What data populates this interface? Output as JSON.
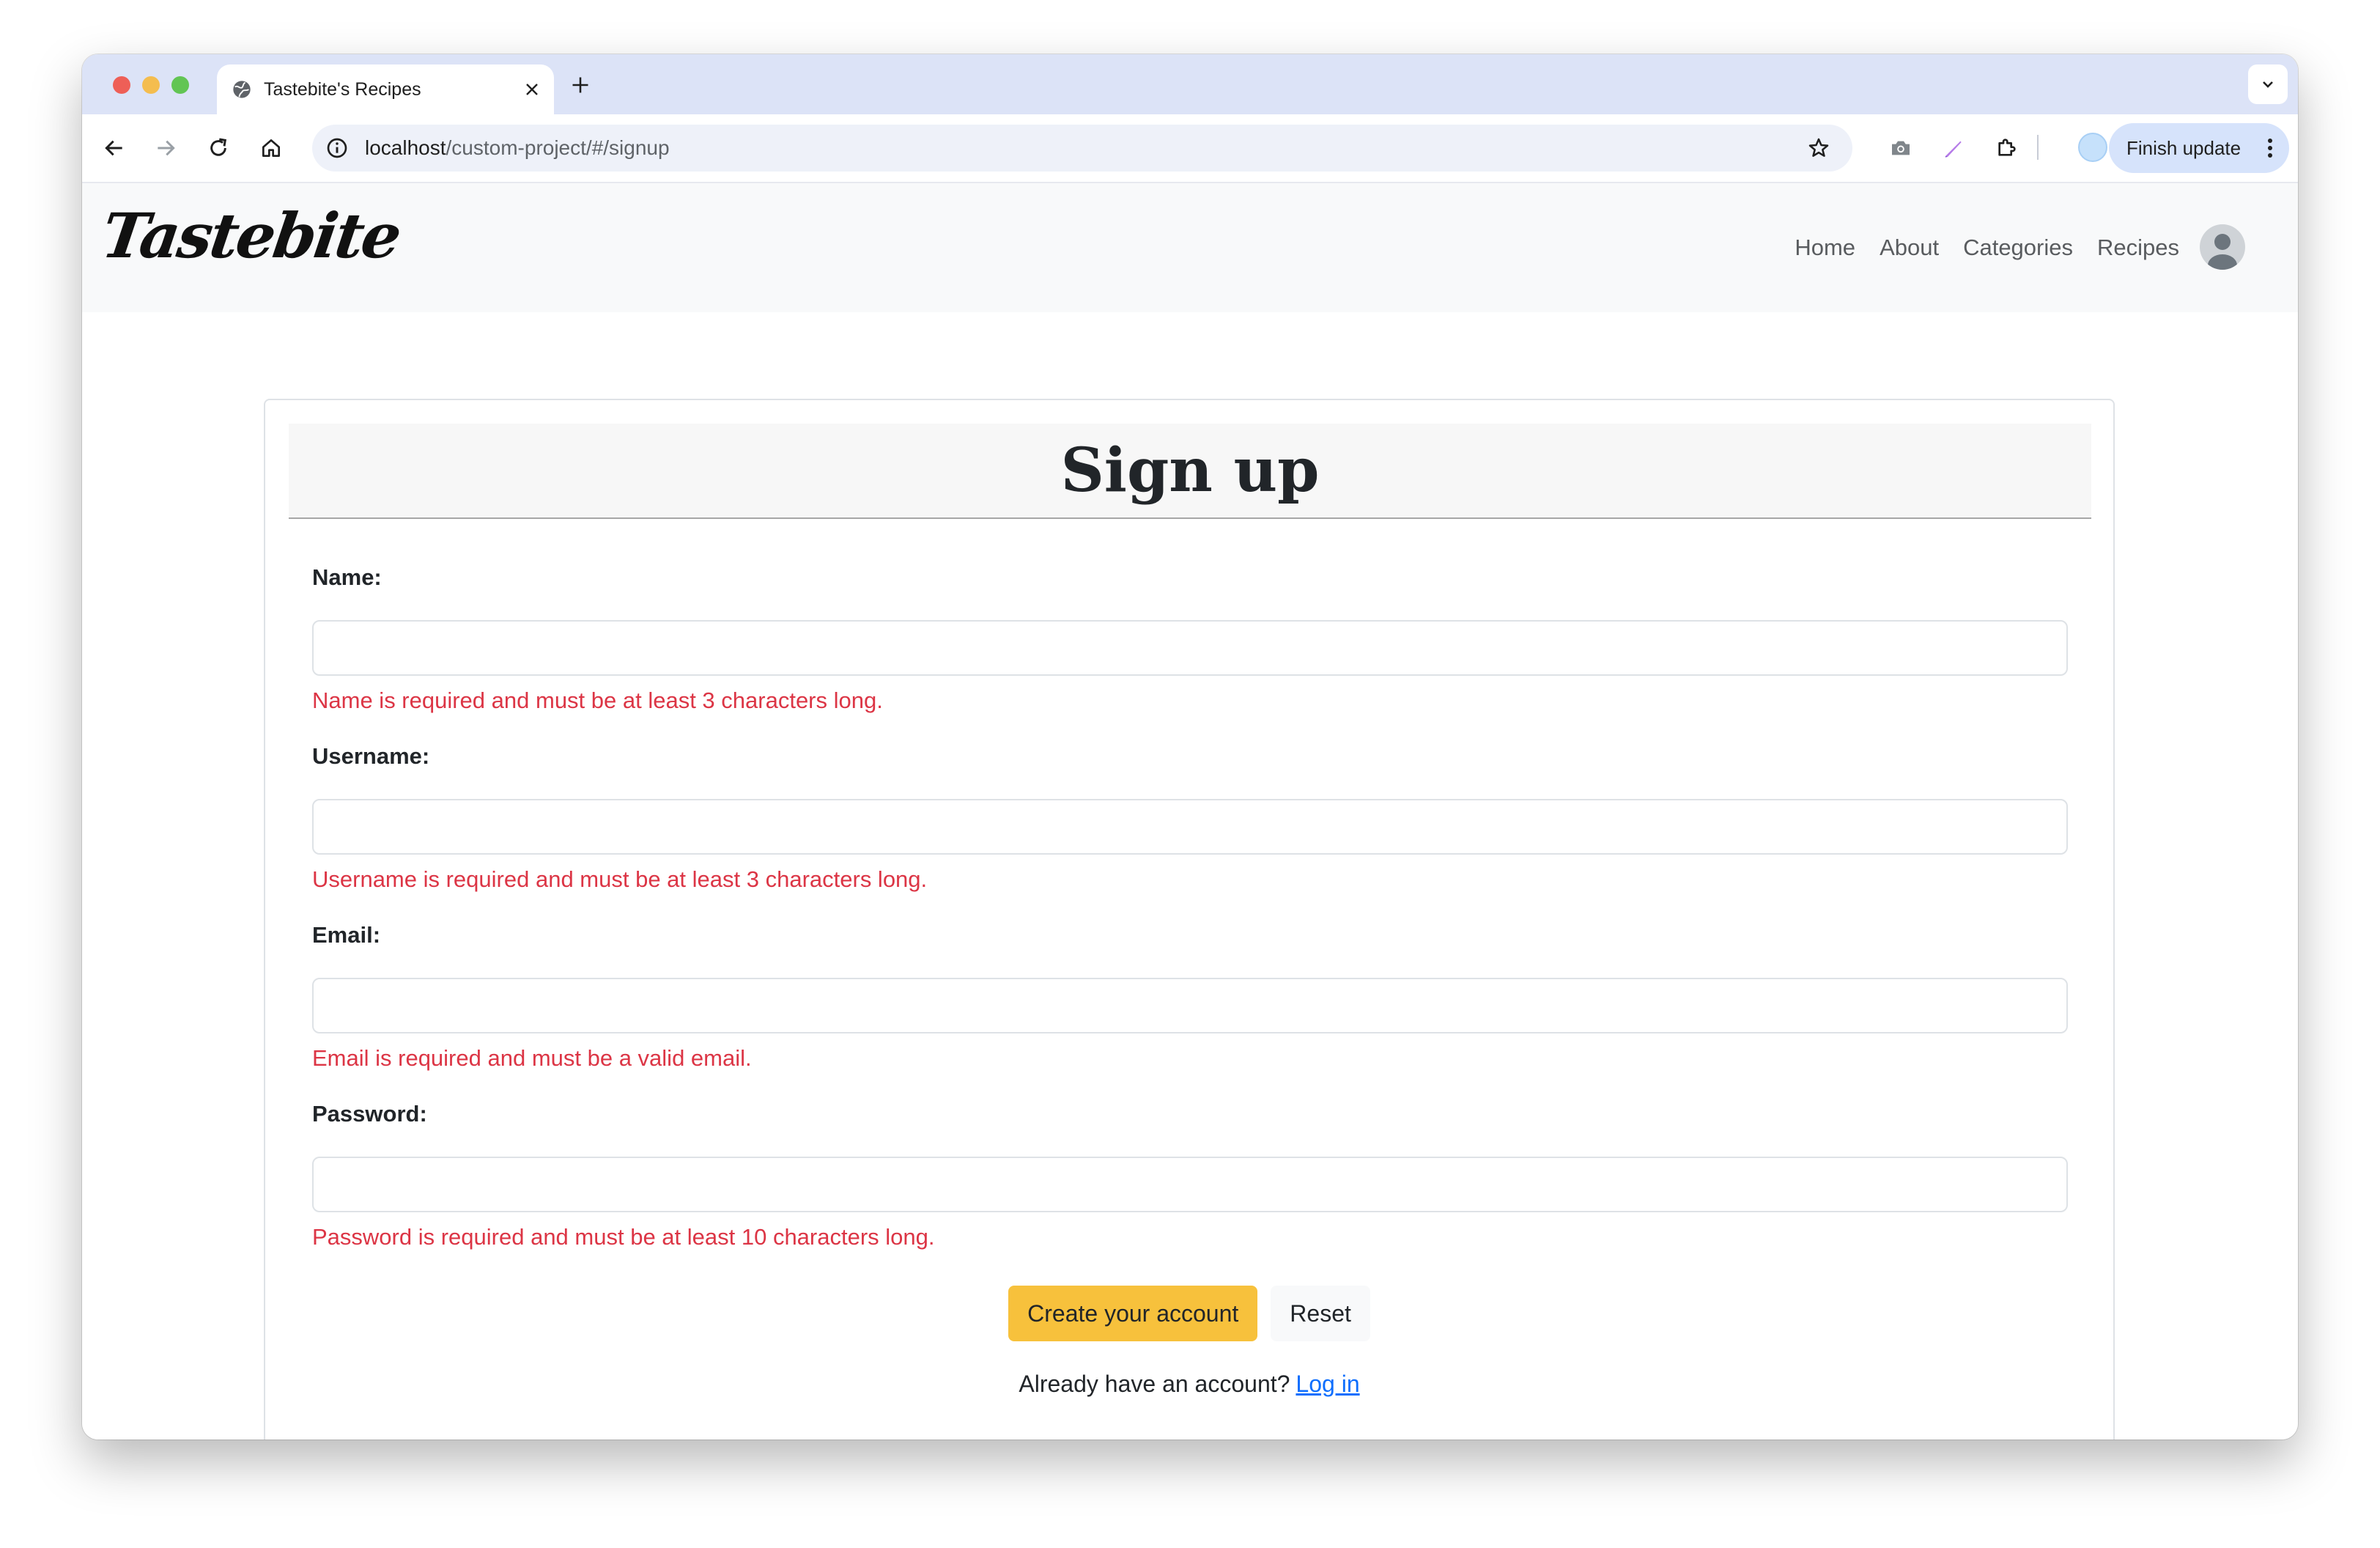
{
  "browser": {
    "tab_title": "Tastebite's Recipes",
    "url_host": "localhost",
    "url_path": "/custom-project/#/signup",
    "update_button": "Finish update"
  },
  "site": {
    "logo": "Tastebite",
    "nav": {
      "home": "Home",
      "about": "About",
      "categories": "Categories",
      "recipes": "Recipes"
    }
  },
  "form": {
    "title": "Sign up",
    "fields": [
      {
        "label": "Name:",
        "value": "",
        "error": "Name is required and must be at least 3 characters long."
      },
      {
        "label": "Username:",
        "value": "",
        "error": "Username is required and must be at least 3 characters long."
      },
      {
        "label": "Email:",
        "value": "",
        "error": "Email is required and must be a valid email."
      },
      {
        "label": "Password:",
        "value": "",
        "error": "Password is required and must be at least 10 characters long."
      }
    ],
    "submit_label": "Create your account",
    "reset_label": "Reset",
    "login_prompt": "Already have an account?",
    "login_link": "Log in"
  },
  "colors": {
    "accent": "#f7c13c",
    "error": "#dc3545",
    "link": "#0d6efd"
  }
}
